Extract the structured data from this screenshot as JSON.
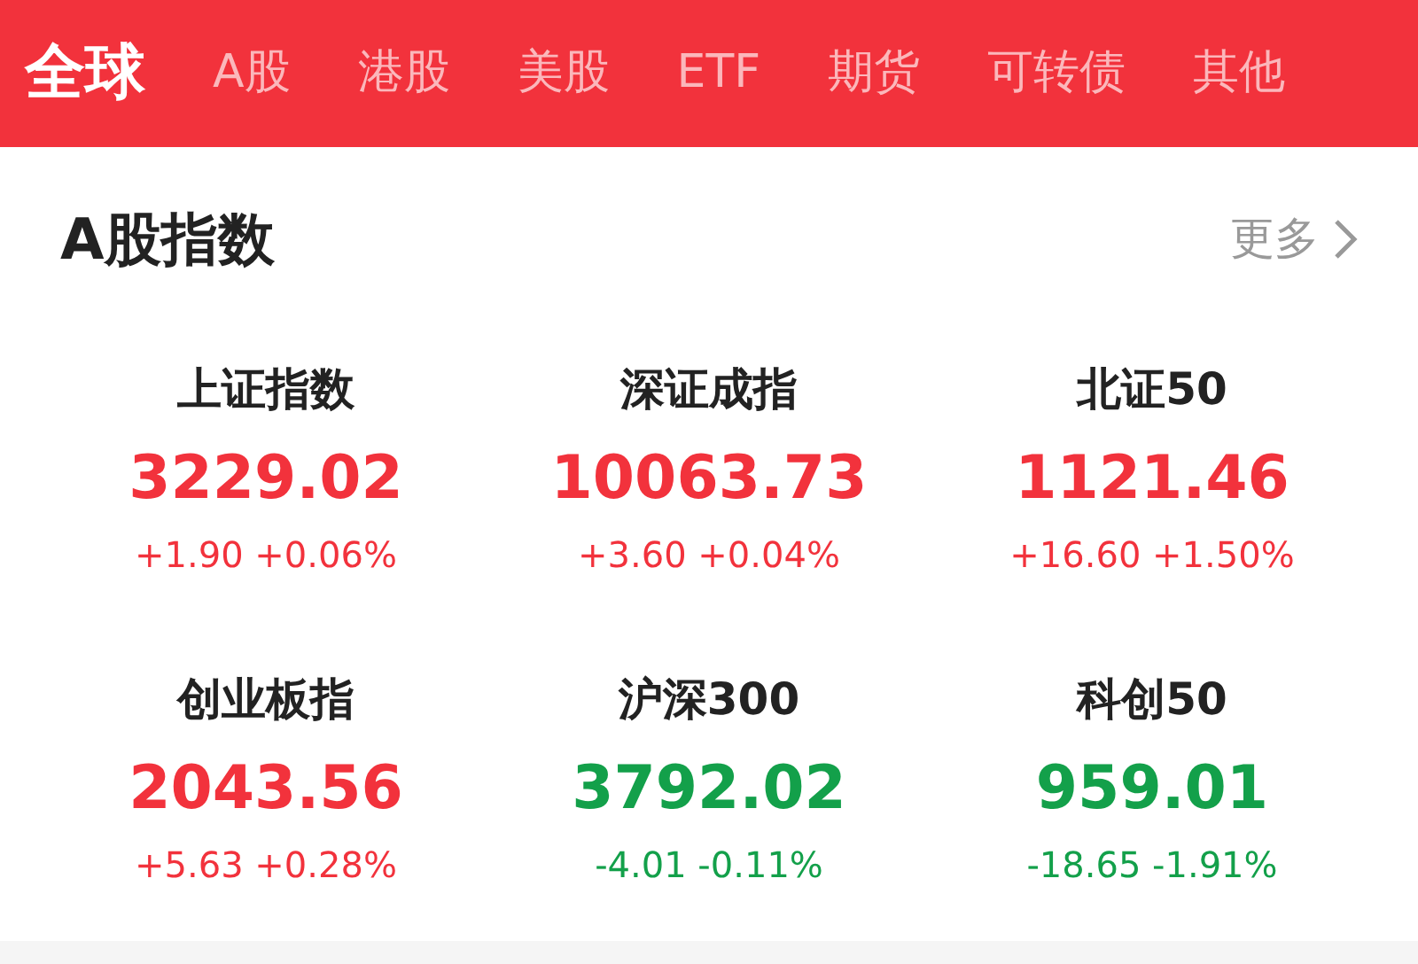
{
  "tabs": [
    {
      "label": "全球",
      "selected": true
    },
    {
      "label": "A股",
      "selected": false
    },
    {
      "label": "港股",
      "selected": false
    },
    {
      "label": "美股",
      "selected": false
    },
    {
      "label": "ETF",
      "selected": false
    },
    {
      "label": "期货",
      "selected": false
    },
    {
      "label": "可转债",
      "selected": false
    },
    {
      "label": "其他",
      "selected": false
    }
  ],
  "section": {
    "title": "A股指数",
    "more": "更多"
  },
  "indices": [
    {
      "name": "上证指数",
      "price": "3229.02",
      "change": "+1.90",
      "percent": "+0.06%",
      "kind": "up"
    },
    {
      "name": "深证成指",
      "price": "10063.73",
      "change": "+3.60",
      "percent": "+0.04%",
      "kind": "up"
    },
    {
      "name": "北证50",
      "price": "1121.46",
      "change": "+16.60",
      "percent": "+1.50%",
      "kind": "up"
    },
    {
      "name": "创业板指",
      "price": "2043.56",
      "change": "+5.63",
      "percent": "+0.28%",
      "kind": "up"
    },
    {
      "name": "沪深300",
      "price": "3792.02",
      "change": "-4.01",
      "percent": "-0.11%",
      "kind": "down"
    },
    {
      "name": "科创50",
      "price": "959.01",
      "change": "-18.65",
      "percent": "-1.91%",
      "kind": "down"
    }
  ]
}
